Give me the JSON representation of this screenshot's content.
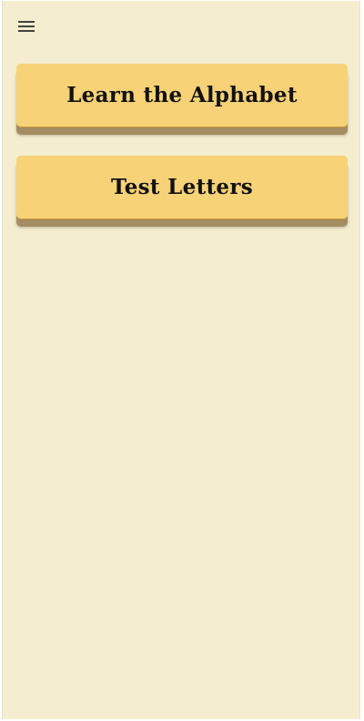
{
  "header": {
    "menu_icon": "hamburger-menu-icon"
  },
  "menu": {
    "items": [
      {
        "label": "Learn the Alphabet"
      },
      {
        "label": "Test Letters"
      }
    ]
  },
  "colors": {
    "background": "#f4edcf",
    "card": "#f8d277",
    "card_shadow": "#a48d62",
    "text": "#111111"
  }
}
